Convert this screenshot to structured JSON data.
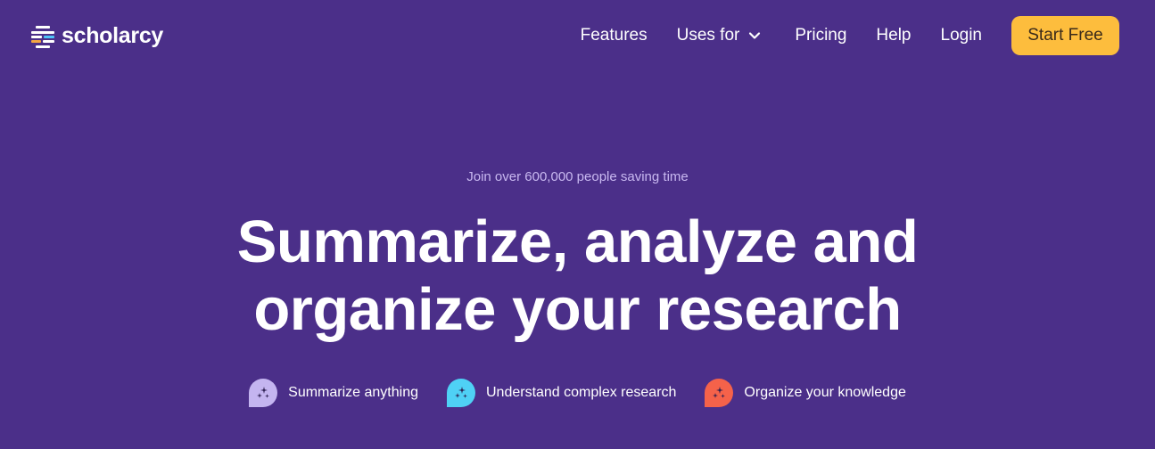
{
  "brand": {
    "name": "scholarcy",
    "logo_colors": {
      "accent_blue": "#4fc3f7",
      "accent_orange": "#f5a742",
      "bars": "#ffffff"
    }
  },
  "nav": {
    "links": [
      {
        "label": "Features"
      },
      {
        "label": "Uses for",
        "has_dropdown": true,
        "icon": "chevron-down-icon"
      },
      {
        "label": "Pricing"
      },
      {
        "label": "Help"
      },
      {
        "label": "Login"
      }
    ],
    "cta_label": "Start Free"
  },
  "hero": {
    "tagline": "Join over 600,000 people saving time",
    "headline_line1": "Summarize, analyze and",
    "headline_line2": "organize your research"
  },
  "features": [
    {
      "label": "Summarize anything",
      "icon": "sparkles-icon",
      "color": "#c4b5f0"
    },
    {
      "label": "Understand complex research",
      "icon": "sparkles-icon",
      "color": "#4fd1f5"
    },
    {
      "label": "Organize your knowledge",
      "icon": "sparkles-icon",
      "color": "#f5624a"
    }
  ],
  "colors": {
    "background": "#4b2f89",
    "cta": "#fdbd3d",
    "tagline": "#c8b8f0"
  }
}
